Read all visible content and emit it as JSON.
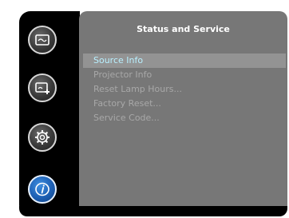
{
  "sidebar": {
    "items": [
      {
        "icon": "image-settings-icon",
        "active": false
      },
      {
        "icon": "display-settings-icon",
        "active": false
      },
      {
        "icon": "gear-icon",
        "active": false
      },
      {
        "icon": "info-icon",
        "active": true
      }
    ]
  },
  "panel": {
    "title": "Status and Service",
    "items": [
      {
        "label": "Source Info",
        "selected": true
      },
      {
        "label": "Projector Info",
        "selected": false
      },
      {
        "label": "Reset Lamp Hours...",
        "selected": false
      },
      {
        "label": "Factory Reset...",
        "selected": false
      },
      {
        "label": "Service Code...",
        "selected": false
      }
    ]
  },
  "colors": {
    "selected_text": "#b8f0ff",
    "normal_text": "#a8a8a8",
    "panel_bg": "#777777",
    "active_icon": "#1d5fb3"
  }
}
